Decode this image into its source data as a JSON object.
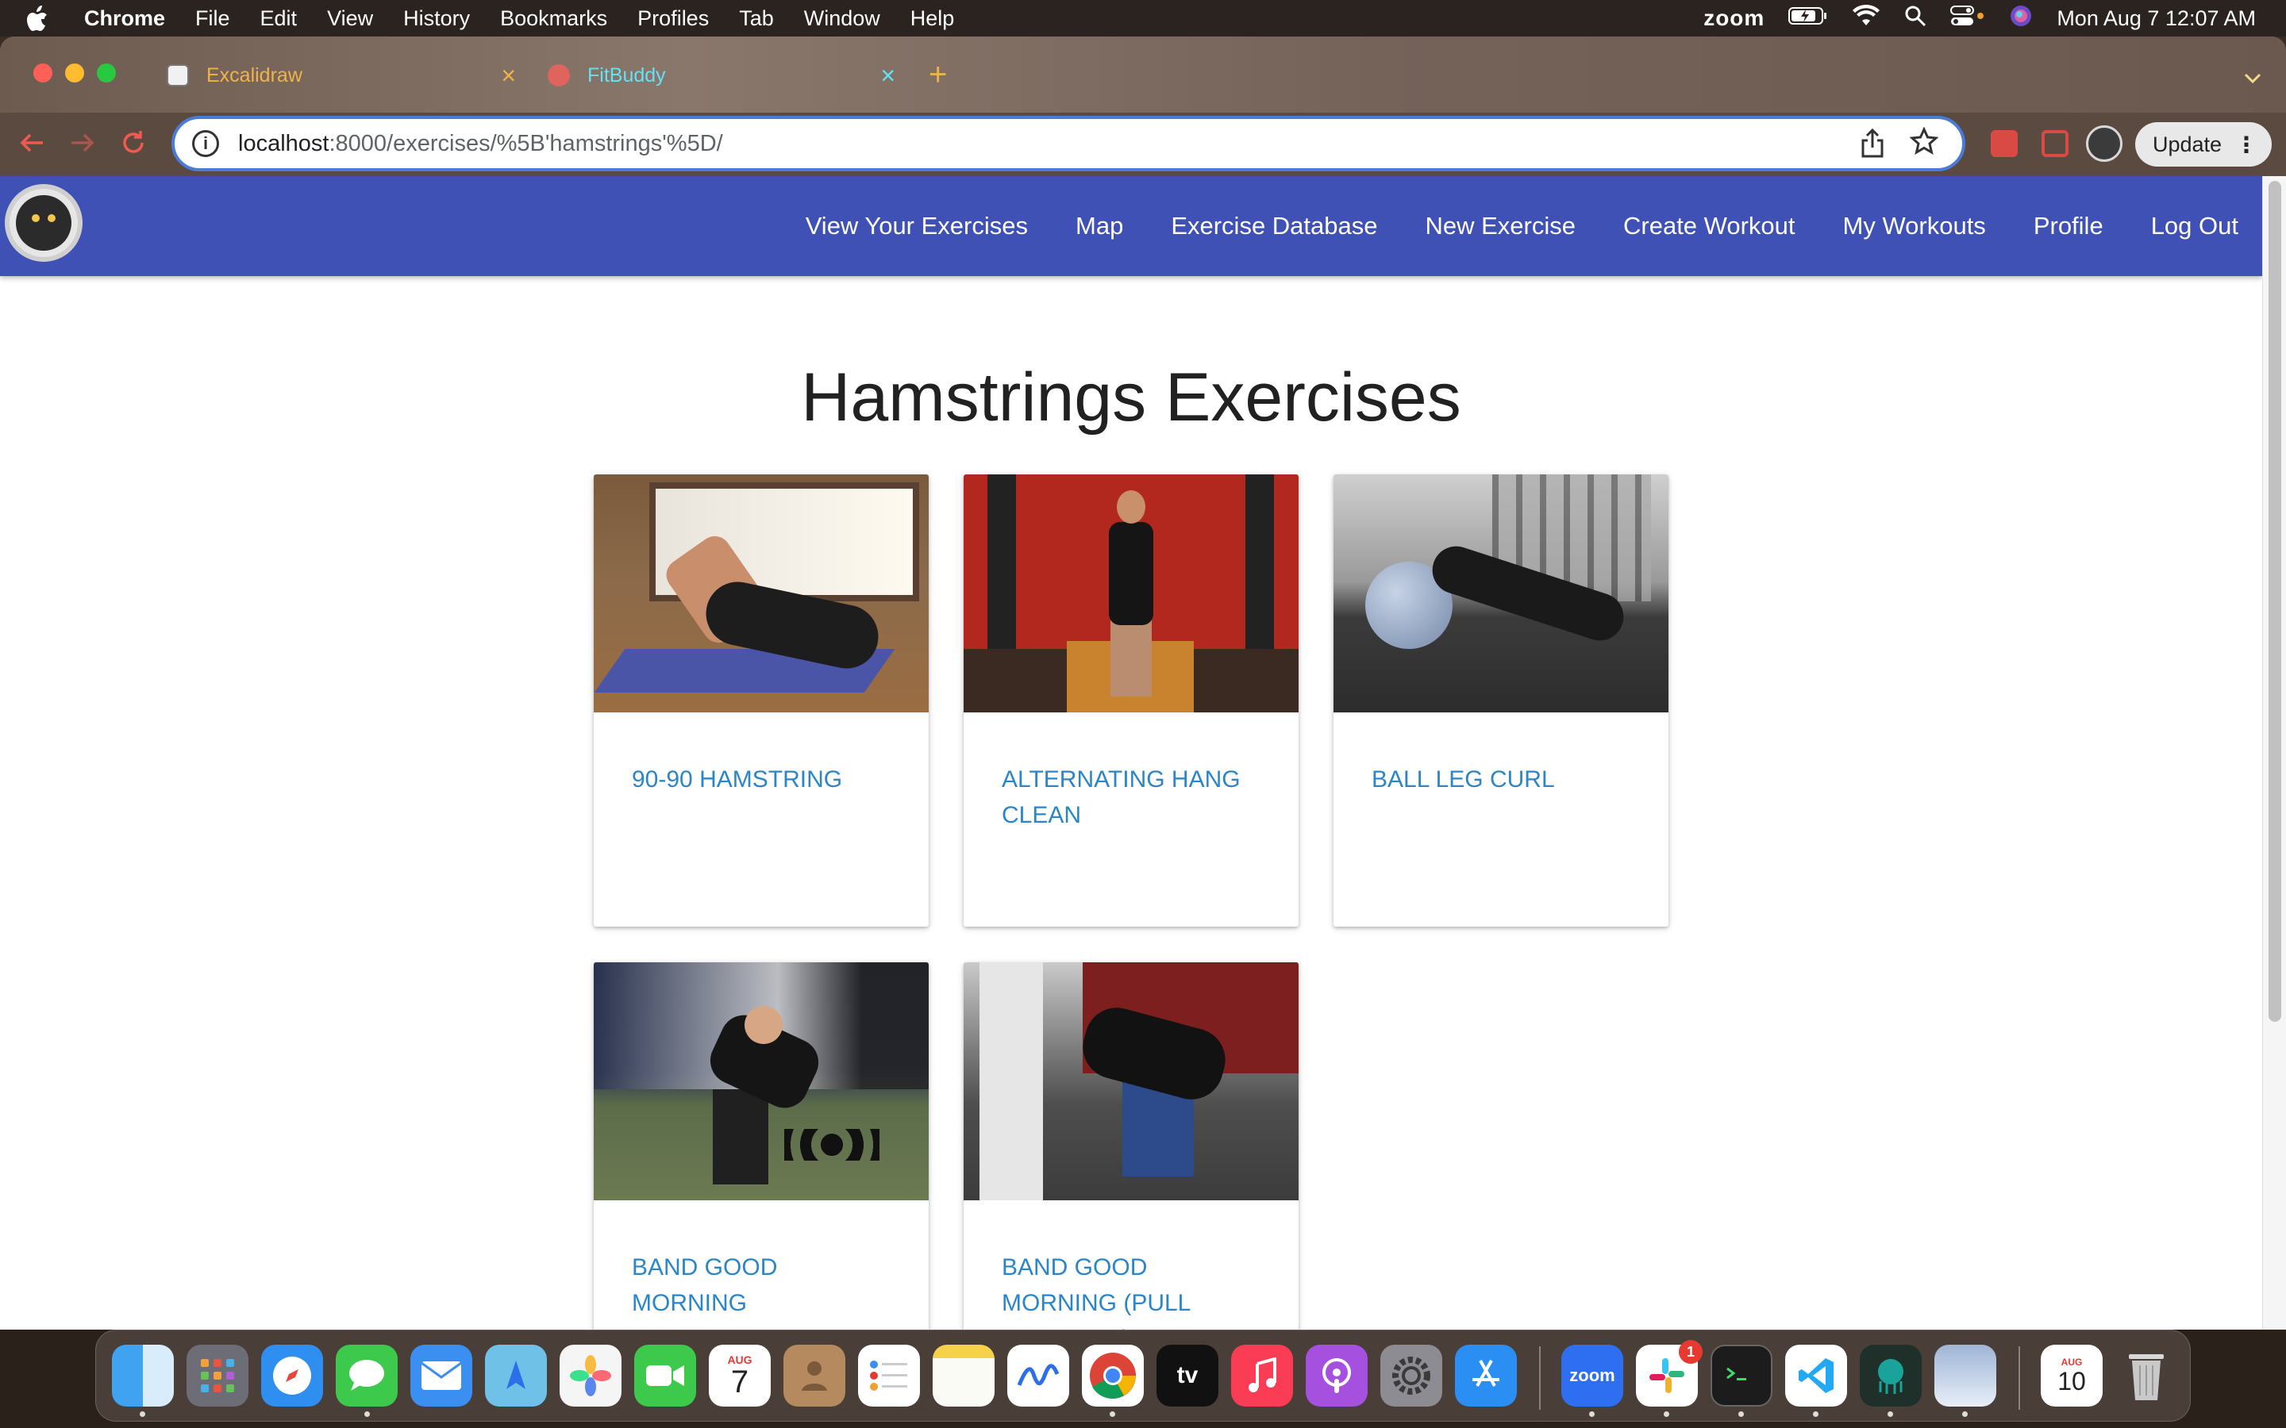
{
  "menubar": {
    "app_name": "Chrome",
    "items": [
      "File",
      "Edit",
      "View",
      "History",
      "Bookmarks",
      "Profiles",
      "Tab",
      "Window",
      "Help"
    ],
    "status": {
      "zoom_label": "zoom",
      "datetime": "Mon Aug 7  12:07 AM"
    }
  },
  "browser": {
    "tabs": [
      {
        "title": "Excalidraw",
        "active": false
      },
      {
        "title": "FitBuddy",
        "active": true
      }
    ],
    "new_tab_symbol": "+",
    "close_symbol": "×",
    "address": {
      "host": "localhost",
      "path": ":8000/exercises/%5B'hamstrings'%5D/"
    },
    "update_label": "Update"
  },
  "app": {
    "nav_links": [
      "View Your Exercises",
      "Map",
      "Exercise Database",
      "New Exercise",
      "Create Workout",
      "My Workouts",
      "Profile",
      "Log Out"
    ],
    "page_title": "Hamstrings Exercises",
    "exercises": [
      {
        "name": "90-90 HAMSTRING"
      },
      {
        "name": "ALTERNATING HANG CLEAN"
      },
      {
        "name": "BALL LEG CURL"
      },
      {
        "name": "BAND GOOD MORNING"
      },
      {
        "name": "BAND GOOD MORNING (PULL THROUGH)"
      }
    ]
  },
  "dock": {
    "calendar_month": "AUG",
    "calendar_day": "7",
    "calendar2_month": "AUG",
    "calendar2_day": "10",
    "slack_badge": "1",
    "zoom_label": "zoom",
    "appletv_label": "tv"
  },
  "colors": {
    "app_nav": "#3f51b5",
    "card_title": "#2b86c9",
    "tab_active": "#63e1f5",
    "tab_inactive": "#f0b24a"
  }
}
